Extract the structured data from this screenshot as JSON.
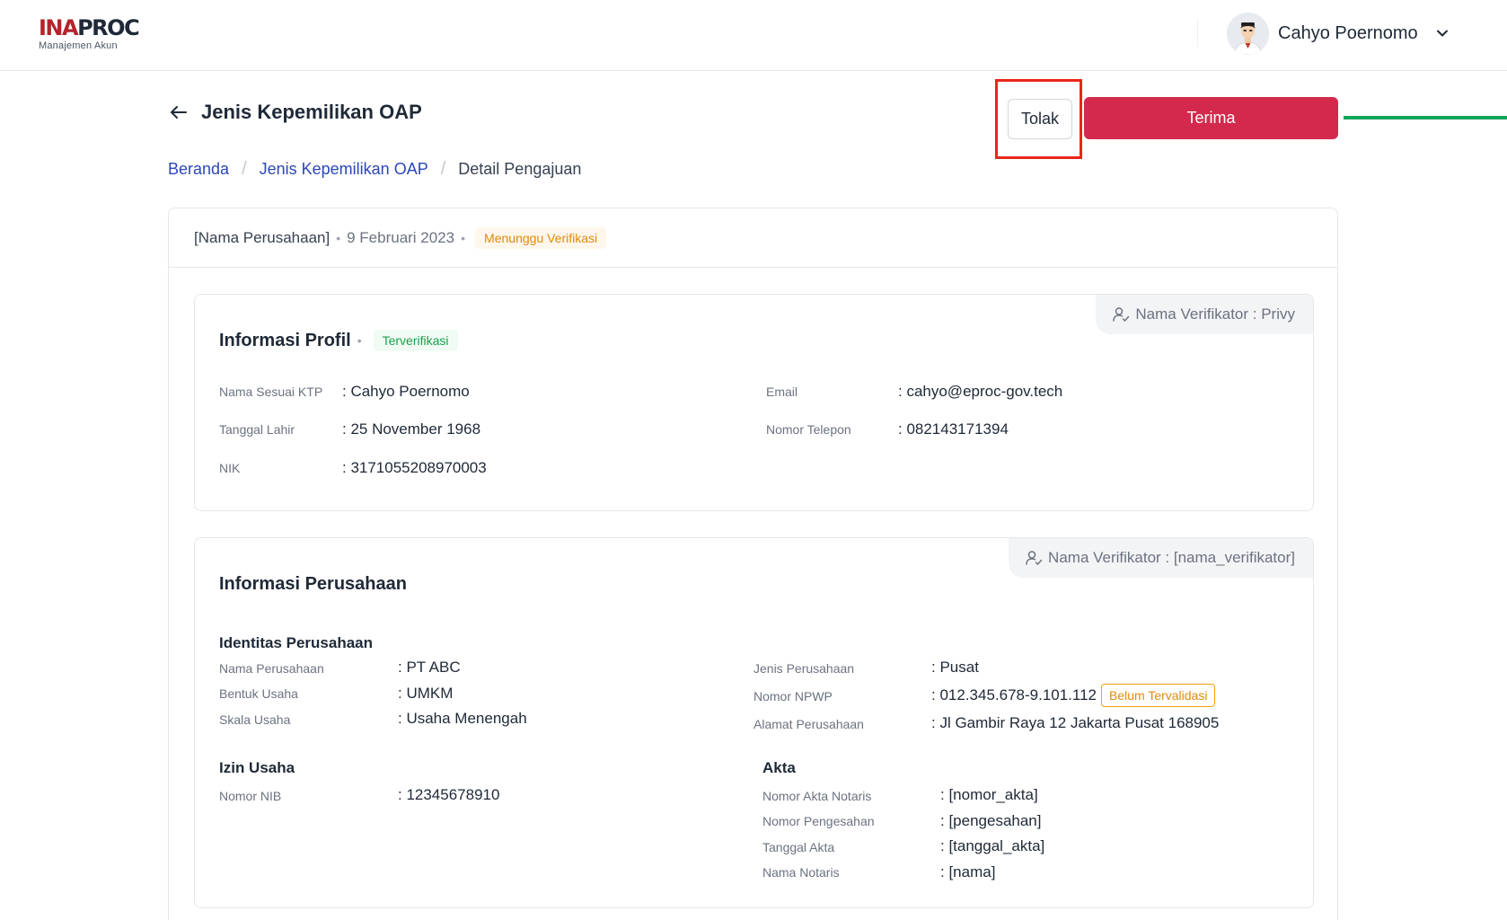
{
  "header": {
    "logo_main_a": "INA",
    "logo_main_b": "PROC",
    "logo_sub": "Manajemen Akun",
    "user_name": "Cahyo Poernomo"
  },
  "page": {
    "title": "Jenis Kepemilikan OAP",
    "reject_label": "Tolak",
    "accept_label": "Terima"
  },
  "breadcrumb": {
    "items": [
      "Beranda",
      "Jenis Kepemilikan OAP"
    ],
    "current": "Detail Pengajuan",
    "separator": "/"
  },
  "submission": {
    "company": "[Nama Perusahaan]",
    "date": "9 Februari 2023",
    "status": "Menunggu Verifikasi",
    "separator": "•"
  },
  "profile": {
    "title": "Informasi Profil",
    "status": "Terverifikasi",
    "verifier": "Nama Verifikator : Privy",
    "fields": [
      {
        "label": "Nama Sesuai KTP",
        "value": ": Cahyo Poernomo"
      },
      {
        "label": "Tanggal Lahir",
        "value": ": 25 November 1968"
      },
      {
        "label": "NIK",
        "value": ": 3171055208970003"
      },
      {
        "label": "Email",
        "value": ": cahyo@eproc-gov.tech"
      },
      {
        "label": "Nomor Telepon",
        "value": ": 082143171394"
      }
    ]
  },
  "company": {
    "title": "Informasi Perusahaan",
    "verifier": "Nama Verifikator : [nama_verifikator]",
    "identity_title": "Identitas Perusahaan",
    "identity_left": [
      {
        "label": "Nama Perusahaan",
        "value": ": PT ABC"
      },
      {
        "label": "Bentuk Usaha",
        "value": ": UMKM"
      },
      {
        "label": "Skala Usaha",
        "value": ": Usaha Menengah"
      }
    ],
    "identity_right": [
      {
        "label": "Jenis Perusahaan",
        "value": ": Pusat"
      },
      {
        "label": "Nomor NPWP",
        "value": ": 012.345.678-9.101.112"
      },
      {
        "label": "Alamat Perusahaan",
        "value": ": Jl Gambir Raya 12 Jakarta Pusat 168905"
      }
    ],
    "npwp_badge": "Belum Tervalidasi",
    "permit_title": "Izin Usaha",
    "permit": [
      {
        "label": "Nomor NIB",
        "value": ": 12345678910"
      }
    ],
    "deed_title": "Akta",
    "deed": [
      {
        "label": "Nomor Akta Notaris",
        "value": ": [nomor_akta]"
      },
      {
        "label": "Nomor Pengesahan",
        "value": ": [pengesahan]"
      },
      {
        "label": "Tanggal Akta",
        "value": ": [tanggal_akta]"
      },
      {
        "label": "Nama Notaris",
        "value": ": [nama]"
      }
    ]
  },
  "colors": {
    "brand_red": "#b4232c",
    "accept_button": "#d3294c",
    "link_blue": "#2b47b8",
    "warning": "#e08a0b",
    "success": "#16a34a",
    "highlight_box": "#e8271a",
    "indicator_line": "#10a65a"
  },
  "icons": {
    "back": "arrow-left-icon",
    "user_menu": "chevron-down-icon",
    "verifier": "user-check-icon"
  }
}
